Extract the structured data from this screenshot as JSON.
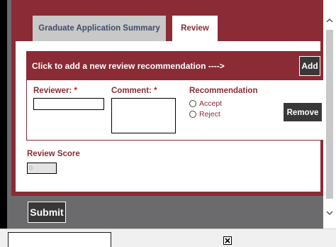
{
  "tabs": [
    {
      "label": "Graduate Application Summary",
      "active": false
    },
    {
      "label": "Review",
      "active": true
    }
  ],
  "review_card": {
    "header_text": "Click to add a new review recommendation ---->",
    "add_label": "Add",
    "reviewer_label": "Reviewer:",
    "comment_label": "Comment:",
    "required_marker": "*",
    "recommendation_label": "Recommendation",
    "options": [
      "Accept",
      "Reject"
    ],
    "remove_label": "Remove"
  },
  "review_score": {
    "label": "Review Score",
    "value": "0"
  },
  "submit_label": "Submit",
  "scrollbar": {
    "up_icon": "chevron-up-icon",
    "down_icon": "chevron-down-icon"
  },
  "colors": {
    "brand": "#8a2b35",
    "button": "#383838",
    "frame": "#6b6b6d",
    "required": "#d01818"
  }
}
